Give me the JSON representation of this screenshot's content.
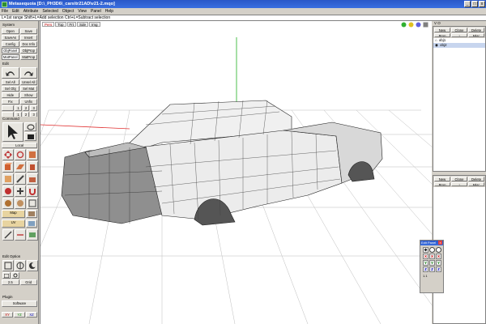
{
  "window": {
    "title": "Metasequoia [D:\\_PH3D6\\_cars\\tr21AD\\v21-2.mqo]",
    "controls": [
      "_",
      "□",
      "x"
    ]
  },
  "menu": [
    "File",
    "Edit",
    "Attribute",
    "Selected",
    "Object",
    "View",
    "Panel",
    "Help"
  ],
  "status": "L=1st range   Shift+L=Add selection   Ctrl+L=Subtract selection",
  "left": {
    "system": {
      "title": "System",
      "open": "Open",
      "save": "Save",
      "saveas": "SaveAs",
      "insert": "Insert",
      "config": "Config",
      "docinfo": "Doc Info",
      "objpanel": "ObjPanel",
      "objprop": "ObjProp",
      "matpanel": "MatPanel",
      "matprop": "MatProp"
    },
    "edit": {
      "title": "Edit",
      "selall": "Sel All",
      "unselall": "Unsel All",
      "selobj": "Sel Obj",
      "selmat": "Sel Mat",
      "hide": "Hide",
      "show": "Show",
      "fix": "Fix",
      "unfix": "Unfix",
      "n1": "1",
      "n2": "2",
      "n3": "3",
      "n4": "4"
    },
    "command": {
      "title": "Command",
      "local": "Local",
      "map": "Map",
      "uv": "UV"
    },
    "editoption": {
      "title": "Edit Option",
      "grid": "Grid",
      "val": "2.5"
    },
    "plugin": {
      "title": "Plugin",
      "software": "Software",
      "xy": "XY",
      "yz": "YZ",
      "xz": "XZ"
    }
  },
  "viewport": {
    "tabs": [
      "Pers",
      "Top",
      "Frt",
      "Sde",
      "Img"
    ],
    "active_tab": "Pers"
  },
  "right": {
    "v_label": "V O",
    "objects_header": {
      "new": "New",
      "clone": "Clone",
      "delete": "Delete",
      "prop": "Prop",
      "up": "↑",
      "misc": "Misc"
    },
    "objects": [
      "obj1",
      "obj2"
    ],
    "materials_header": {
      "new": "New",
      "clone": "Clone",
      "delete": "Delete",
      "prop": "Prop",
      "up": "↑",
      "misc": "Misc"
    }
  },
  "edit_panel": {
    "title": "Edit Panel",
    "x": "X",
    "y": "Y",
    "z": "Z",
    "value": "1.1"
  },
  "colors": {
    "titlebar": "#2a58c8",
    "panel": "#d4d0c8",
    "x_axis": "#e03030",
    "y_axis": "#20b020"
  }
}
